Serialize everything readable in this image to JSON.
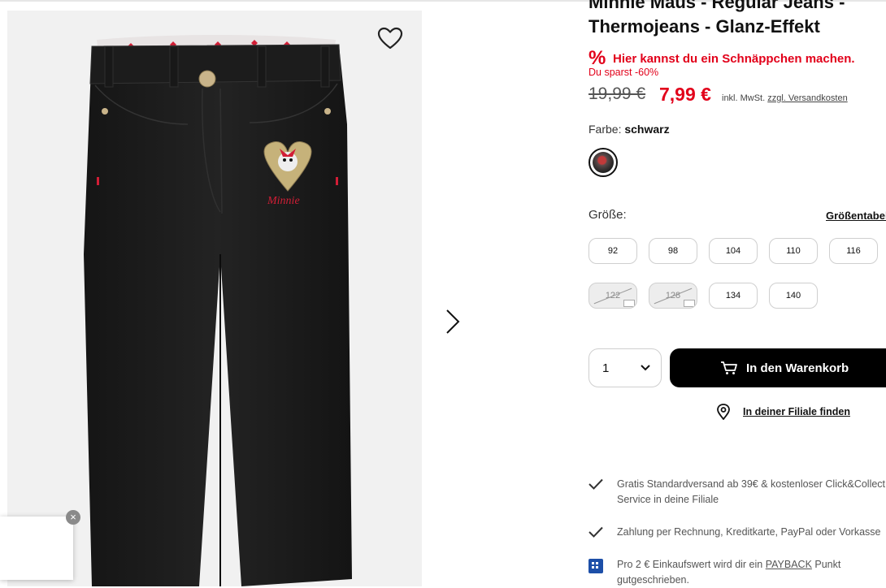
{
  "product": {
    "title": "Minnie Maus - Regular Jeans - Thermojeans - Glanz-Effekt"
  },
  "deal": {
    "icon": "percent-icon",
    "text": "Hier kannst du ein Schnäppchen machen.",
    "saving": "Du sparst -60%"
  },
  "price": {
    "old": "19,99 €",
    "new": "7,99 €",
    "vat": "inkl. MwSt.",
    "shipping_link": "zzgl. Versandkosten"
  },
  "color": {
    "label": "Farbe:",
    "value": "schwarz",
    "swatch_color": "#1b1b1b"
  },
  "sizes": {
    "label": "Größe:",
    "table_link": "Größentabelle",
    "options": [
      {
        "label": "92",
        "available": true
      },
      {
        "label": "98",
        "available": true
      },
      {
        "label": "104",
        "available": true
      },
      {
        "label": "110",
        "available": true
      },
      {
        "label": "116",
        "available": true
      },
      {
        "label": "122",
        "available": false
      },
      {
        "label": "128",
        "available": false
      },
      {
        "label": "134",
        "available": true
      },
      {
        "label": "140",
        "available": true
      }
    ]
  },
  "cart": {
    "quantity": "1",
    "button_label": "In den Warenkorb",
    "button_icon": "cart-icon"
  },
  "store": {
    "label": "In deiner Filiale finden",
    "icon": "location-pin-icon"
  },
  "benefits": {
    "shipping": "Gratis Standardversand ab 39€ & kostenloser Click&Collect Service in deine Filiale",
    "payment": "Zahlung per Rechnung, Kreditkarte, PayPal oder Vorkasse",
    "payback_before": "Pro 2 € Einkaufswert wird dir ein ",
    "payback_link": "PAYBACK",
    "payback_after": " Punkt gutgeschrieben."
  },
  "colors": {
    "accent_red": "#e2001a",
    "button_black": "#000000",
    "payback_blue": "#1d4fa8"
  }
}
